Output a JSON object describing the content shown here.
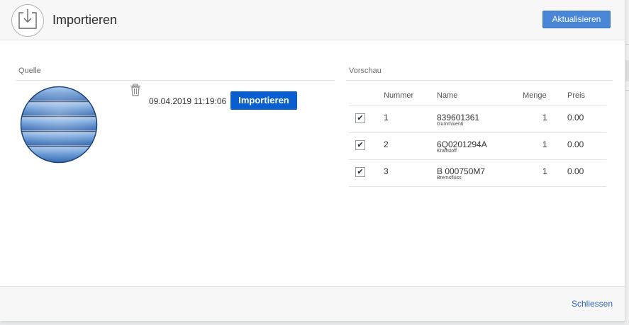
{
  "dialog": {
    "title": "Importieren",
    "refresh_label": "Aktualisieren",
    "close_label": "Schliessen"
  },
  "source": {
    "label": "Quelle",
    "timestamp": "09.04.2019 11:19:06",
    "import_label": "Importieren"
  },
  "preview": {
    "label": "Vorschau",
    "columns": {
      "nummer": "Nummer",
      "name": "Name",
      "menge": "Menge",
      "preis": "Preis"
    },
    "rows": [
      {
        "checked": true,
        "nummer": "1",
        "name": "839601361",
        "sub": "Gummiventi",
        "menge": "1",
        "preis": "0.00"
      },
      {
        "checked": true,
        "nummer": "2",
        "name": "6Q0201294A",
        "sub": "Kraftstoff",
        "menge": "1",
        "preis": "0.00"
      },
      {
        "checked": true,
        "nummer": "3",
        "name": "B 000750M7",
        "sub": "Bremsflüss",
        "menge": "1",
        "preis": "0.00"
      }
    ]
  },
  "icons": {
    "header": "import-download-icon",
    "trash": "trash-icon",
    "checkbox": "checkmark-icon"
  },
  "colors": {
    "primary_button": "#0a5fd0",
    "refresh_button": "#4a86d6",
    "link": "#2a63c4"
  }
}
